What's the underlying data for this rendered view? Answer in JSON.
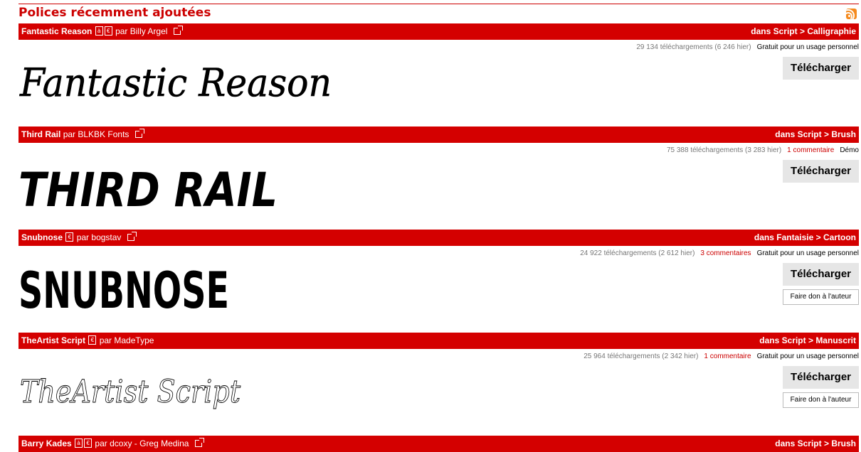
{
  "section_title": "Polices récemment ajoutées",
  "rss_icon": "rss-icon",
  "entries": [
    {
      "name": "Fantastic Reason",
      "badges": [
        "à",
        "€"
      ],
      "par": "par",
      "author": "Billy Argel",
      "category_prefix": "dans",
      "category": "Script",
      "subcategory": "Calligraphie",
      "downloads": "29 134 téléchargements (6 246 hier)",
      "comments": "",
      "license": "Gratuit pour un usage personnel",
      "download_label": "Télécharger",
      "donate_label": "",
      "preview_text": "Fantastic Reason"
    },
    {
      "name": "Third Rail",
      "badges": [],
      "par": "par",
      "author": "BLKBK Fonts",
      "category_prefix": "dans",
      "category": "Script",
      "subcategory": "Brush",
      "downloads": "75 388 téléchargements (3 283 hier)",
      "comments": "1 commentaire",
      "license": "Démo",
      "download_label": "Télécharger",
      "donate_label": "",
      "preview_text": "THIRD RAIL"
    },
    {
      "name": "Snubnose",
      "badges": [
        "€"
      ],
      "par": "par",
      "author": "bogstav",
      "category_prefix": "dans",
      "category": "Fantaisie",
      "subcategory": "Cartoon",
      "downloads": "24 922 téléchargements (2 612 hier)",
      "comments": "3 commentaires",
      "license": "Gratuit pour un usage personnel",
      "download_label": "Télécharger",
      "donate_label": "Faire don à l'auteur",
      "preview_text": "SNUBNOSE"
    },
    {
      "name": "TheArtist Script",
      "badges": [
        "€"
      ],
      "par": "par",
      "author": "MadeType",
      "category_prefix": "dans",
      "category": "Script",
      "subcategory": "Manuscrit",
      "downloads": "25 964 téléchargements (2 342 hier)",
      "comments": "1 commentaire",
      "license": "Gratuit pour un usage personnel",
      "download_label": "Télécharger",
      "donate_label": "Faire don à l'auteur",
      "preview_text": "TheArtist Script"
    },
    {
      "name": "Barry Kades",
      "badges": [
        "à",
        "€"
      ],
      "par": "par",
      "author": "dcoxy - Greg Medina",
      "category_prefix": "dans",
      "category": "Script",
      "subcategory": "Brush",
      "downloads": "",
      "comments": "",
      "license": "",
      "download_label": "",
      "donate_label": "",
      "preview_text": ""
    }
  ]
}
